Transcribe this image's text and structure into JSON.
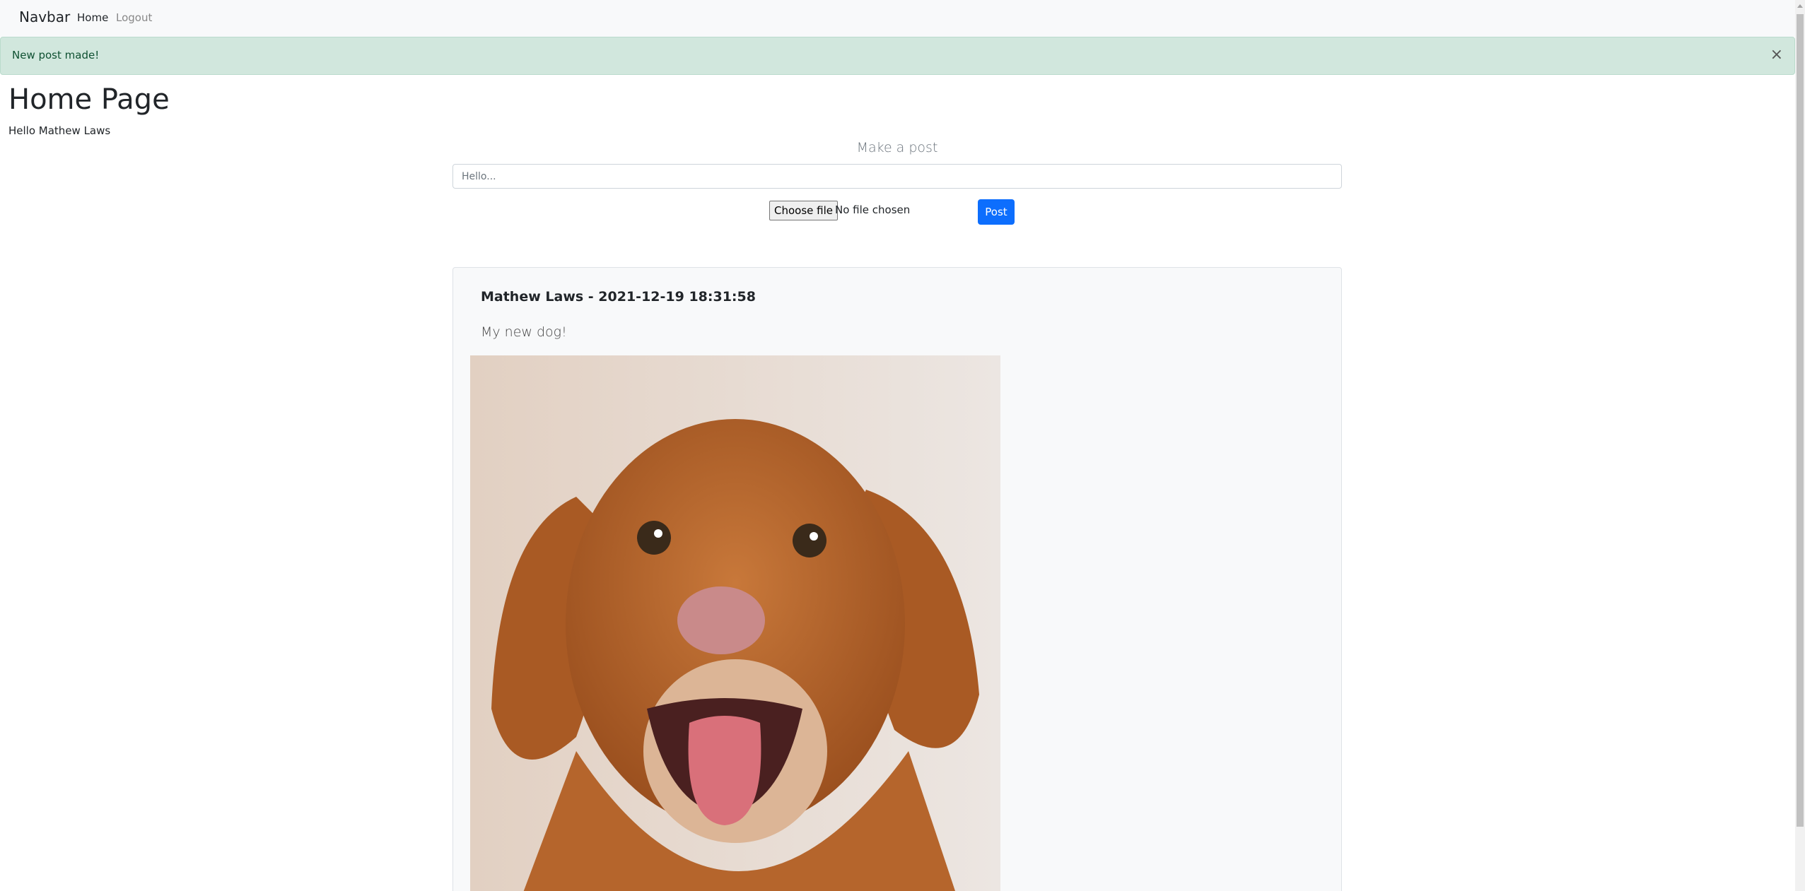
{
  "navbar": {
    "brand": "Navbar",
    "links": [
      "Home",
      "Logout"
    ]
  },
  "alert": {
    "message": "New post made!",
    "close": "×"
  },
  "page": {
    "title": "Home Page",
    "greeting": "Hello Mathew Laws"
  },
  "composer": {
    "heading": "Make a post",
    "placeholder": "Hello...",
    "file_button": "Choose file",
    "file_status": "No file chosen",
    "post_label": "Post"
  },
  "posts": [
    {
      "header": "Mathew Laws - 2021-12-19 18:31:58",
      "text": "My new dog!",
      "image": "dog-photo"
    }
  ],
  "colors": {
    "primary": "#0d6efd",
    "alert_bg": "#d1e7dd",
    "navbar_bg": "#f8f9fa"
  }
}
